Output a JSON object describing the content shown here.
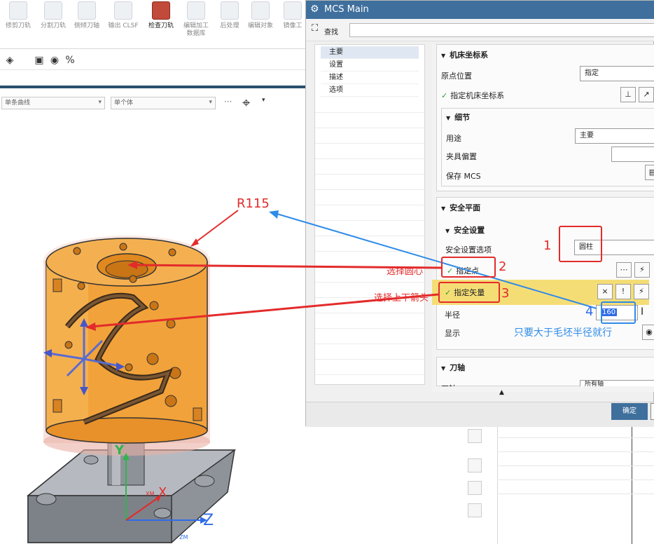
{
  "ribbon": {
    "items": [
      {
        "label": "修剪刀轨"
      },
      {
        "label": "分割刀轨"
      },
      {
        "label": "侧倾刀轴"
      },
      {
        "label": "输出 CLSF"
      },
      {
        "label": "检查刀轨"
      },
      {
        "label": "编辑加工",
        "label2": "数据库"
      },
      {
        "label": "后处理"
      },
      {
        "label": "编辑对象"
      },
      {
        "label": "镜像工"
      }
    ]
  },
  "selection_bar": {
    "filter": "单条曲线",
    "scope": "单个体"
  },
  "dialog": {
    "title": "MCS Main",
    "find_label": "查找",
    "nav": [
      "主要",
      "设置",
      "描述",
      "选项"
    ],
    "groups": {
      "machine_csys": {
        "header": "机床坐标系",
        "origin_label": "原点位置",
        "origin_value": "指定",
        "specify_mcs": "指定机床坐标系"
      },
      "details": {
        "header": "细节",
        "purpose_label": "用途",
        "purpose_value": "主要",
        "fixture_offset_label": "夹具偏置",
        "save_mcs_label": "保存 MCS"
      },
      "clearance": {
        "header": "安全平面",
        "sub_header": "安全设置",
        "option_label": "安全设置选项",
        "option_value": "圆柱",
        "specify_point": "指定点",
        "specify_vector": "指定矢量",
        "radius_label": "半径",
        "radius_value": "160",
        "display_label": "显示"
      },
      "tool_axis": {
        "header": "刀轴",
        "label": "刀轴",
        "value": "所有轴"
      }
    },
    "ok_label": "确定"
  },
  "annotations": {
    "r115": "R115",
    "n1": "1",
    "n2": "2",
    "n3": "3",
    "n4": "4",
    "select_center": "选择圆心",
    "select_arrow": "选择上下箭头",
    "radius_note": "只要大于毛坯半径就行",
    "axis_x": "X",
    "axis_y": "Y",
    "axis_z": "Z",
    "axis_xm": "XM",
    "axis_zm": "ZM"
  },
  "colors": {
    "title_bar": "#3f6f9c",
    "highlight_row": "#f5dd76",
    "part_orange": "#f2a23a",
    "annotation_red": "#e32b2b",
    "annotation_blue": "#2f8be8"
  }
}
